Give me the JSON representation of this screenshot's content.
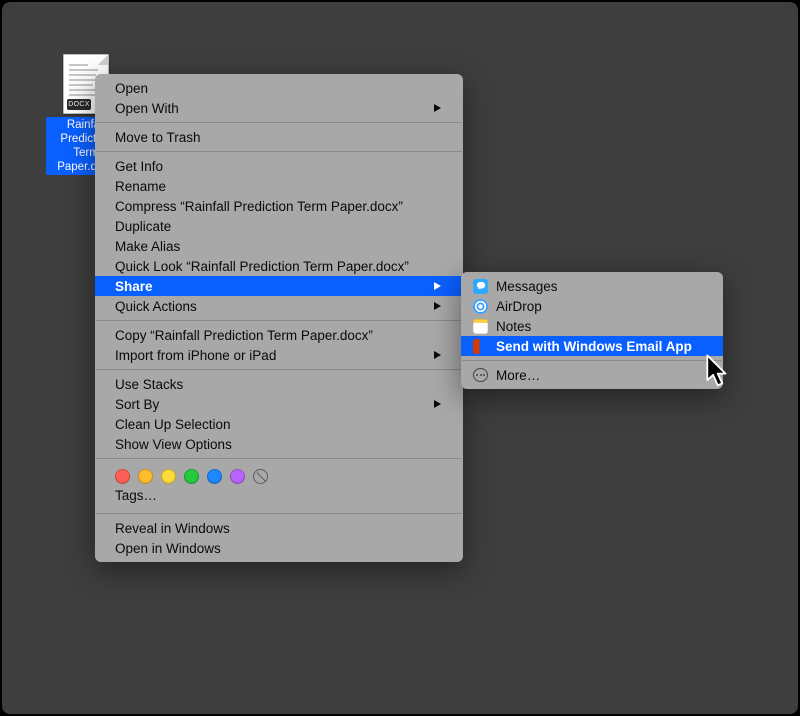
{
  "file": {
    "name": "Rainfall Prediction Term Paper.docx",
    "ext_badge": "DOCX"
  },
  "context_menu": {
    "open": "Open",
    "open_with": "Open With",
    "trash": "Move to Trash",
    "get_info": "Get Info",
    "rename": "Rename",
    "compress": "Compress “Rainfall Prediction Term Paper.docx”",
    "duplicate": "Duplicate",
    "make_alias": "Make Alias",
    "quick_look": "Quick Look “Rainfall Prediction Term Paper.docx”",
    "share": "Share",
    "quick_actions": "Quick Actions",
    "copy": "Copy “Rainfall Prediction Term Paper.docx”",
    "import_iphone": "Import from iPhone or iPad",
    "use_stacks": "Use Stacks",
    "sort_by": "Sort By",
    "clean_up": "Clean Up Selection",
    "view_options": "Show View Options",
    "tags_label": "Tags…",
    "reveal": "Reveal in Windows",
    "open_in": "Open in Windows"
  },
  "share_submenu": {
    "messages": "Messages",
    "airdrop": "AirDrop",
    "notes": "Notes",
    "win_email": "Send with Windows Email App",
    "more": "More…"
  },
  "tag_colors": [
    "#ff5f56",
    "#ffbd2e",
    "#fddb3a",
    "#27c93f",
    "#1e88ff",
    "#b964ff"
  ]
}
